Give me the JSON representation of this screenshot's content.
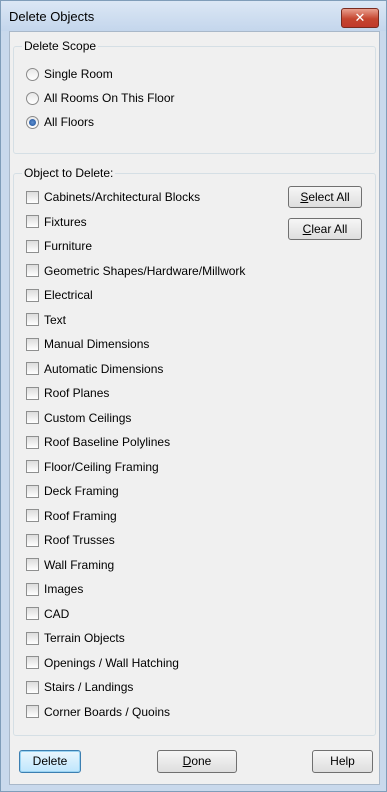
{
  "window": {
    "title": "Delete Objects",
    "close_glyph": "✕"
  },
  "scope": {
    "label": "Delete Scope",
    "options": [
      {
        "label": "Single Room",
        "selected": false
      },
      {
        "label": "All Rooms On This Floor",
        "selected": false
      },
      {
        "label": "All Floors",
        "selected": true
      }
    ]
  },
  "objects": {
    "label": "Object to Delete:",
    "items": [
      "Cabinets/Architectural Blocks",
      "Fixtures",
      "Furniture",
      "Geometric Shapes/Hardware/Millwork",
      "Electrical",
      "Text",
      "Manual Dimensions",
      "Automatic Dimensions",
      "Roof Planes",
      "Custom Ceilings",
      "Roof Baseline Polylines",
      "Floor/Ceiling Framing",
      "Deck Framing",
      "Roof Framing",
      "Roof Trusses",
      "Wall Framing",
      "Images",
      "CAD",
      "Terrain Objects",
      "Openings / Wall Hatching",
      "Stairs / Landings",
      "Corner Boards / Quoins"
    ],
    "select_all": {
      "mnemonic": "S",
      "rest": "elect All"
    },
    "clear_all": {
      "mnemonic": "C",
      "rest": "lear All"
    }
  },
  "footer": {
    "delete_label": "Delete",
    "done_mnemonic": "D",
    "done_rest": "one",
    "help_label": "Help"
  }
}
